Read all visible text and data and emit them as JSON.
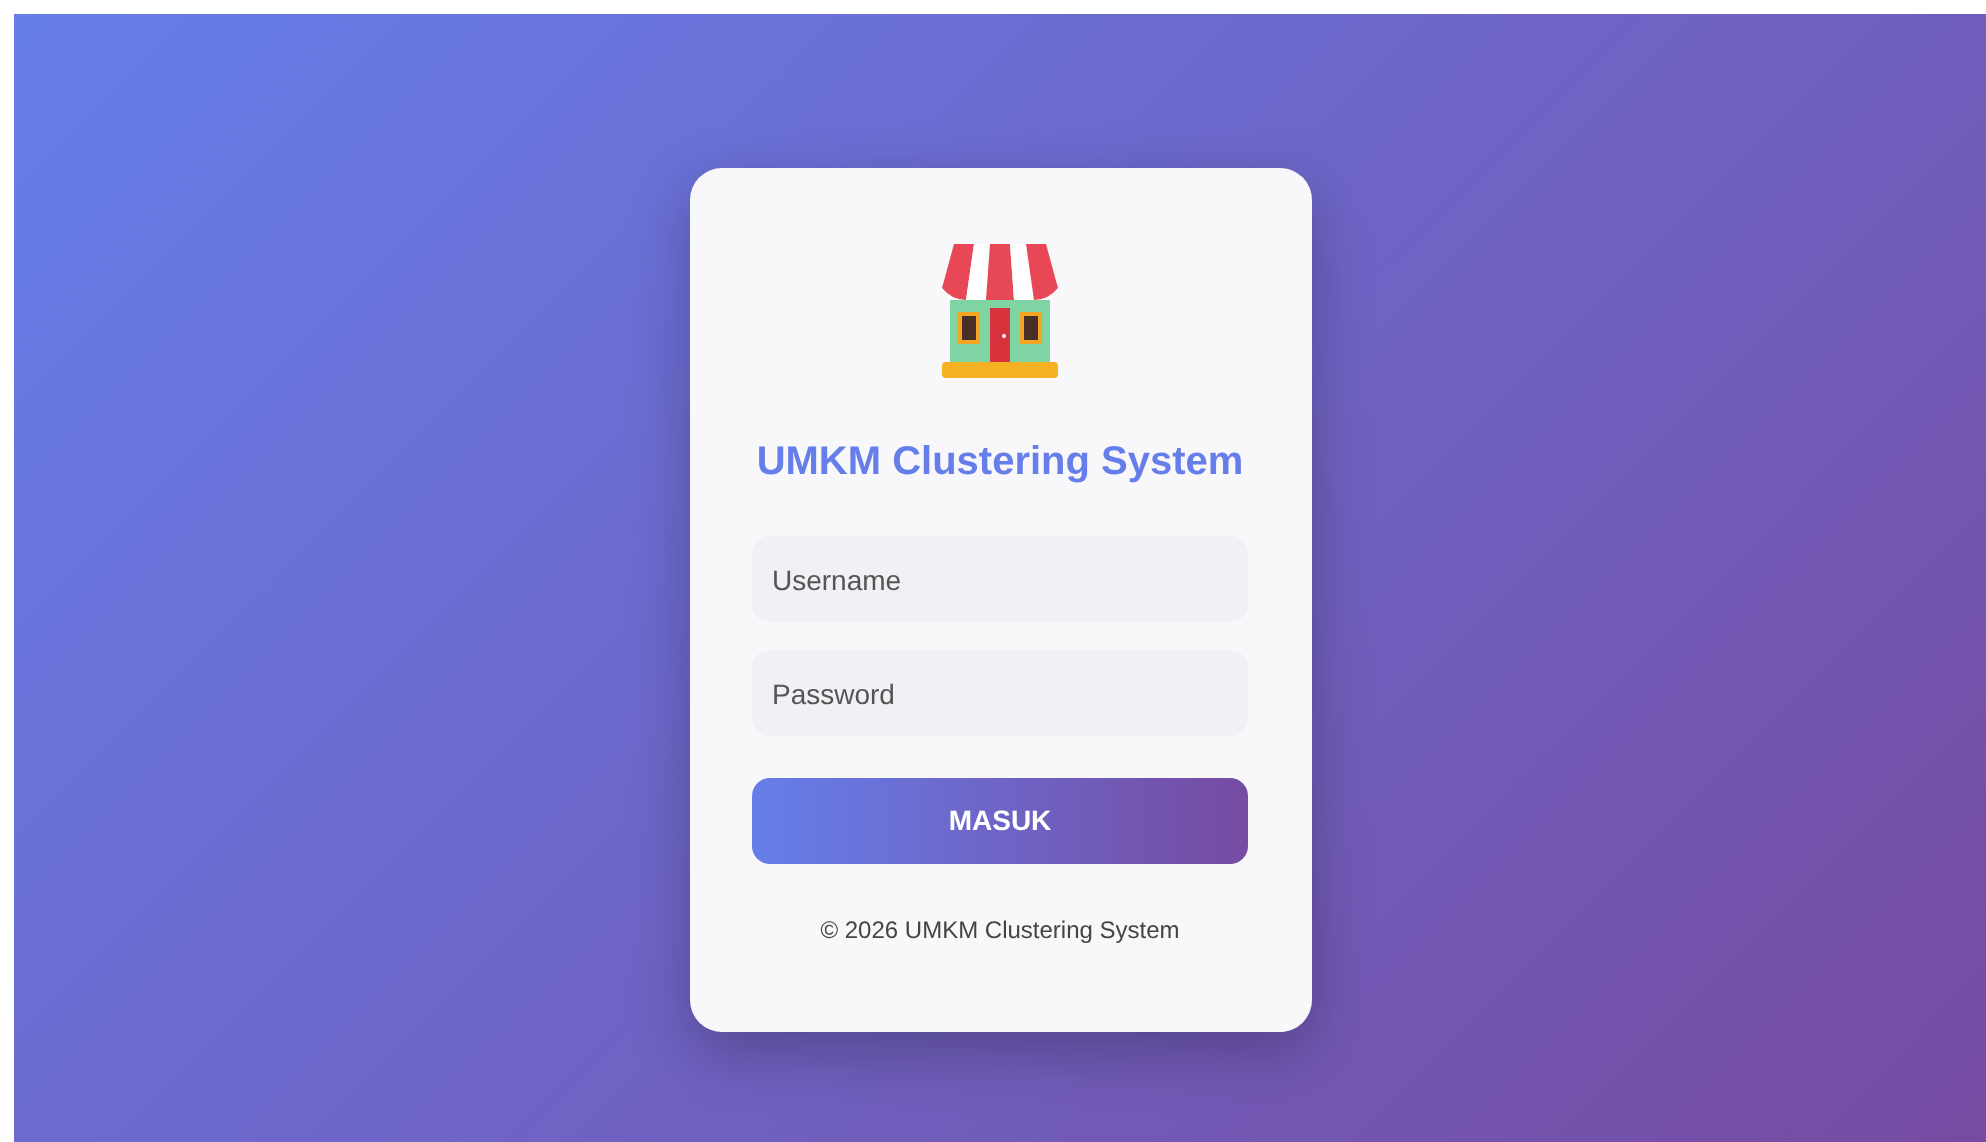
{
  "title": "UMKM Clustering System",
  "fields": [
    {
      "placeholder": "Username"
    },
    {
      "placeholder": "Password"
    }
  ],
  "button": "MASUK",
  "footer": "© 2026 UMKM Clustering System"
}
